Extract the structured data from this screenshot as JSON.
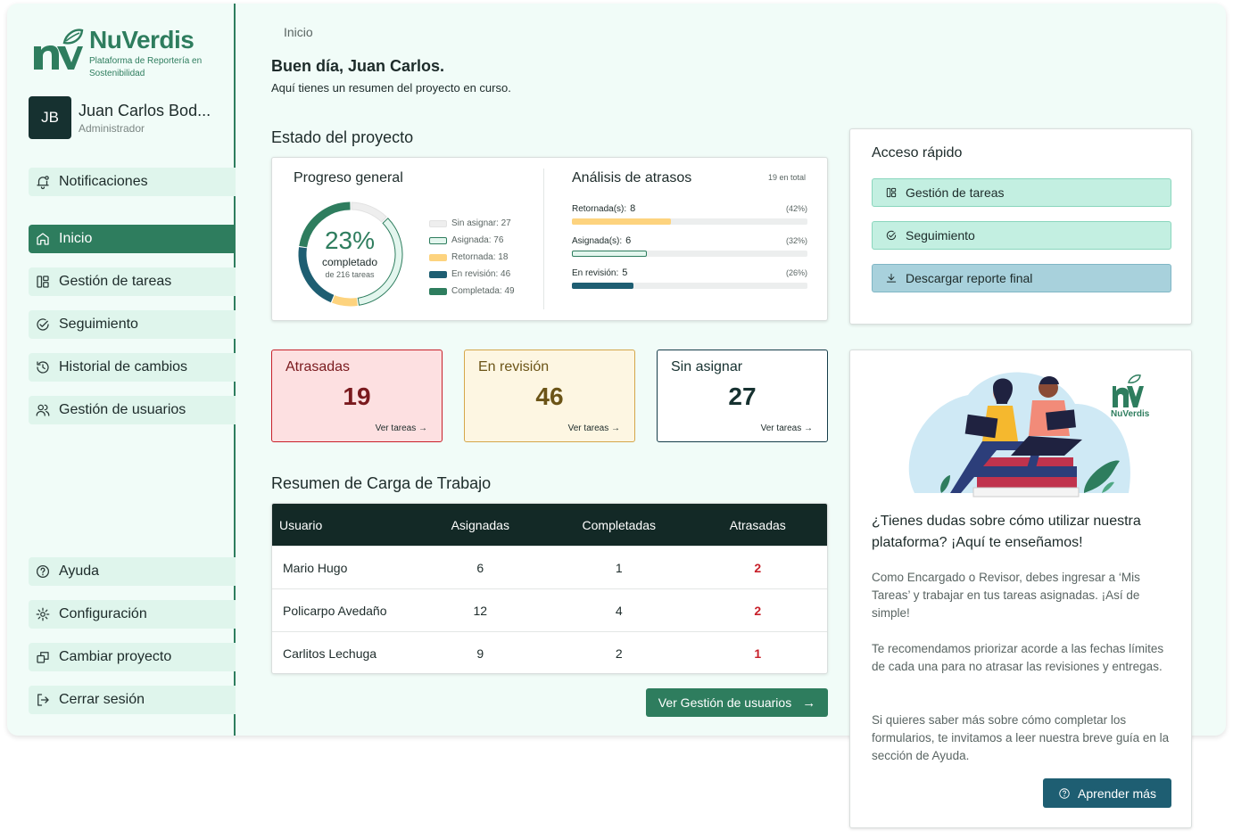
{
  "brand": {
    "name": "NuVerdis",
    "subtitle": "Plataforma de Reportería en Sostenibilidad",
    "illustration_logo_text": "NuVerdis",
    "color": "#2e7d5e"
  },
  "user": {
    "initials": "JB",
    "name": "Juan Carlos Bod...",
    "role": "Administrador"
  },
  "sidebar": {
    "top_items": [
      {
        "label": "Notificaciones",
        "icon": "bell-icon"
      }
    ],
    "main_items": [
      {
        "label": "Inicio",
        "icon": "home-icon",
        "active": true
      },
      {
        "label": "Gestión de tareas",
        "icon": "layout-icon"
      },
      {
        "label": "Seguimiento",
        "icon": "check-circle-icon"
      },
      {
        "label": "Historial de cambios",
        "icon": "history-icon"
      },
      {
        "label": "Gestión de usuarios",
        "icon": "users-icon"
      }
    ],
    "bottom_items": [
      {
        "label": "Ayuda",
        "icon": "help-circle-icon"
      },
      {
        "label": "Configuración",
        "icon": "gear-icon"
      },
      {
        "label": "Cambiar proyecto",
        "icon": "switch-icon"
      },
      {
        "label": "Cerrar sesión",
        "icon": "logout-icon"
      }
    ]
  },
  "breadcrumb": "Inicio",
  "greeting": {
    "title": "Buen día, Juan Carlos.",
    "subtitle": "Aquí tienes un resumen del proyecto en curso."
  },
  "project_status": {
    "title": "Estado del proyecto",
    "progress": {
      "title": "Progreso general",
      "percent_label": "23%",
      "percent_value": 23,
      "completed_label": "completado",
      "total_label": "de 216 tareas",
      "legend": [
        {
          "label": "Sin asignar: 27",
          "value": 27,
          "color": "#eeeeee",
          "border": "#e2e2e2"
        },
        {
          "label": "Asignada: 76",
          "value": 76,
          "color": "#e3f6ee",
          "border": "#2e7d5e"
        },
        {
          "label": "Retornada: 18",
          "value": 18,
          "color": "#fdd37e",
          "border": "#fdd37e"
        },
        {
          "label": "En revisión: 46",
          "value": 46,
          "color": "#1e5e72",
          "border": "#1e5e72"
        },
        {
          "label": "Completada: 49",
          "value": 49,
          "color": "#2e7d5e",
          "border": "#2e7d5e"
        }
      ]
    },
    "delays": {
      "title": "Análisis de atrasos",
      "total": "19 en total",
      "rows": [
        {
          "label": "Retornada(s):",
          "count": "8",
          "pct": "(42%)",
          "fraction": 0.42,
          "color": "#fdd37e",
          "outline": false
        },
        {
          "label": "Asignada(s):",
          "count": "6",
          "pct": "(32%)",
          "fraction": 0.32,
          "color": "#e3f6ee",
          "outline": true
        },
        {
          "label": "En revisión:",
          "count": "5",
          "pct": "(26%)",
          "fraction": 0.26,
          "color": "#1e5e72",
          "outline": false
        }
      ]
    }
  },
  "stats": [
    {
      "title": "Atrasadas",
      "value": "19",
      "link": "Ver tareas",
      "bg": "#fde0e1",
      "border": "#c8202a",
      "title_color": "#7a1a1e",
      "value_color": "#7a1a1e"
    },
    {
      "title": "En revisión",
      "value": "46",
      "link": "Ver tareas",
      "bg": "#fdf6e2",
      "border": "#d4a64a",
      "title_color": "#6b5417",
      "value_color": "#6b5417"
    },
    {
      "title": "Sin asignar",
      "value": "27",
      "link": "Ver tareas",
      "bg": "#ffffff",
      "border": "#163d4a",
      "title_color": "#163130",
      "value_color": "#163130"
    }
  ],
  "workload": {
    "title": "Resumen de Carga de Trabajo",
    "headers": [
      "Usuario",
      "Asignadas",
      "Completadas",
      "Atrasadas"
    ],
    "rows": [
      [
        "Mario Hugo",
        "6",
        "1",
        "2"
      ],
      [
        "Policarpo Avedaño",
        "12",
        "4",
        "2"
      ],
      [
        "Carlitos Lechuga",
        "9",
        "2",
        "1"
      ]
    ],
    "button": "Ver Gestión de usuarios"
  },
  "quick_access": {
    "title": "Acceso rápido",
    "buttons": [
      {
        "label": "Gestión de tareas",
        "icon": "layout-icon",
        "style": "green"
      },
      {
        "label": "Seguimiento",
        "icon": "check-circle-icon",
        "style": "green"
      },
      {
        "label": "Descargar reporte final",
        "icon": "download-icon",
        "style": "blue"
      }
    ]
  },
  "help": {
    "question": "¿Tienes dudas sobre cómo utilizar nuestra plataforma? ¡Aquí te enseñamos!",
    "paragraphs": [
      "Como Encargado o Revisor, debes ingresar a ‘Mis Tareas’ y trabajar en tus tareas asignadas. ¡Así de simple!",
      "Te recomendamos priorizar acorde a las fechas límites de cada una para no atrasar las revisiones y entregas.",
      "Si quieres saber más sobre cómo completar los formularios, te invitamos a leer nuestra breve guía en la sección de Ayuda."
    ],
    "button": "Aprender más"
  }
}
